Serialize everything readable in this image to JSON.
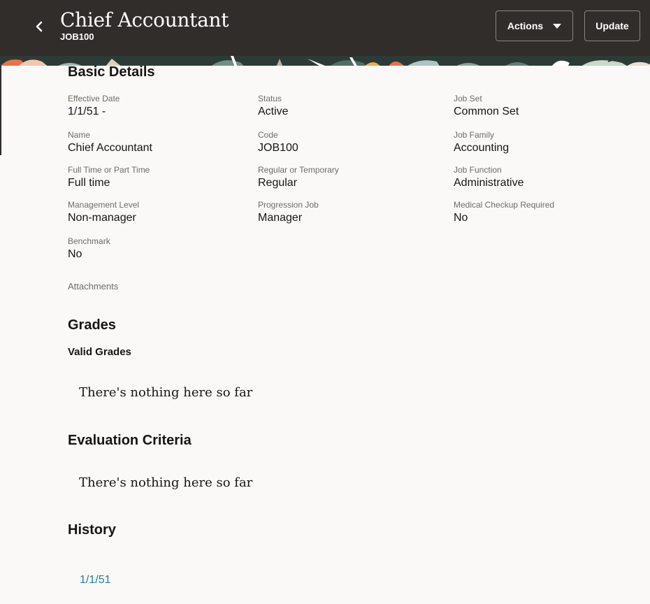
{
  "header": {
    "title": "Chief Accountant",
    "subtitle": "JOB100",
    "actions_label": "Actions",
    "update_label": "Update",
    "back_icon": "chevron-left-icon",
    "background_color": "#312d2a"
  },
  "basic_details": {
    "title": "Basic Details",
    "fields": [
      {
        "label": "Effective Date",
        "value": "1/1/51 -"
      },
      {
        "label": "Status",
        "value": "Active"
      },
      {
        "label": "Job Set",
        "value": "Common Set"
      },
      {
        "label": "Name",
        "value": "Chief Accountant"
      },
      {
        "label": "Code",
        "value": "JOB100"
      },
      {
        "label": "Job Family",
        "value": "Accounting"
      },
      {
        "label": "Full Time or Part Time",
        "value": "Full time"
      },
      {
        "label": "Regular or Temporary",
        "value": "Regular"
      },
      {
        "label": "Job Function",
        "value": "Administrative"
      },
      {
        "label": "Management Level",
        "value": "Non-manager"
      },
      {
        "label": "Progression Job",
        "value": "Manager"
      },
      {
        "label": "Medical Checkup Required",
        "value": "No"
      },
      {
        "label": "Benchmark",
        "value": "No"
      }
    ],
    "attachments_label": "Attachments"
  },
  "grades": {
    "title": "Grades",
    "valid_grades_title": "Valid Grades",
    "empty_message": "There's nothing here so far"
  },
  "evaluation_criteria": {
    "title": "Evaluation Criteria",
    "empty_message": "There's nothing here so far"
  },
  "history": {
    "title": "History",
    "entries": [
      "1/1/51"
    ],
    "link_color": "#227e9e"
  }
}
